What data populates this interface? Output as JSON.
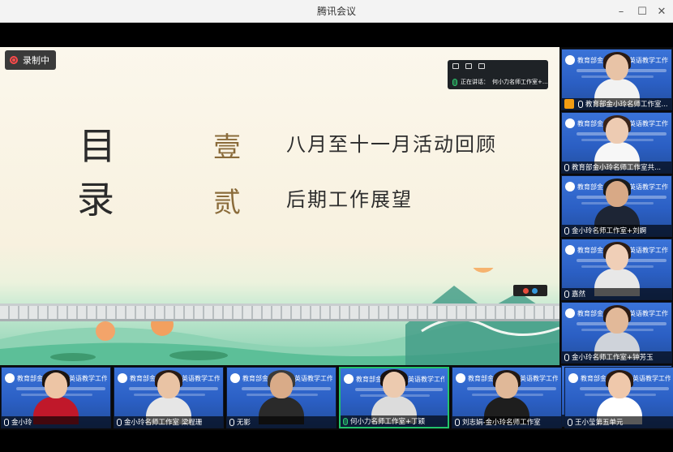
{
  "window": {
    "title": "腾讯会议",
    "controls": {
      "minimize": "–",
      "maximize": "☐",
      "close": "✕"
    }
  },
  "recording": {
    "label": "录制中"
  },
  "slide": {
    "toc_char_1": "目",
    "toc_char_2": "录",
    "items": [
      {
        "num": "壹",
        "text": "八月至十一月活动回顾"
      },
      {
        "num": "贰",
        "text": "后期工作展望"
      }
    ]
  },
  "speaker_panel": {
    "label": "正在讲话：",
    "speaker": "何小力名师工作室+..."
  },
  "side_tiles": [
    {
      "banner": "教育部金小玲快乐英语教学工作室",
      "caption": "教育部金小玲名师工作室...",
      "host": true,
      "face": "#e8c3a6",
      "hair": "#2a1a14",
      "body": "#f2f2f2"
    },
    {
      "banner": "教育部金小玲快乐英语教学工作室",
      "caption": "教育部金小玲名师工作室共...",
      "host": false,
      "face": "#edcbb2",
      "hair": "#3a2419",
      "body": "#f7f7f7"
    },
    {
      "banner": "教育部金小玲快乐英语教学工作室",
      "caption": "金小玲名师工作室+刘婀",
      "host": false,
      "face": "#d8a986",
      "hair": "#1a1a1a",
      "body": "#1d2535"
    },
    {
      "banner": "教育部金小玲快乐英语教学工作室",
      "caption": "嘉然",
      "host": false,
      "face": "#f0cfb7",
      "hair": "#2d1d15",
      "body": "#e8e8e8"
    },
    {
      "banner": "教育部金小玲快乐英语教学工作室",
      "caption": "金小玲名师工作室+钟芳玉",
      "host": false,
      "face": "#e2b999",
      "hair": "#2b1a12",
      "body": "#cfd3da"
    },
    {
      "banner": "教育部金小玲快乐英语教学工作室",
      "caption": "王小莹第五单元",
      "host": false,
      "face": "#efc8ab",
      "hair": "#2a1a12",
      "body": "#ffffff"
    }
  ],
  "bottom_tiles": [
    {
      "banner": "教育部金小玲快乐英语教学工作室",
      "caption": "金小玲",
      "active": false,
      "face": "#edc5a5",
      "hair": "#1c1410",
      "body": "#c0182a"
    },
    {
      "banner": "教育部金小玲快乐英语教学工作室",
      "caption": "金小玲名师工作室 梁程珊",
      "active": false,
      "face": "#e9c3a4",
      "hair": "#2a1b14",
      "body": "#e6e6e6"
    },
    {
      "banner": "教育部金小玲快乐英语教学工作室",
      "caption": "无影",
      "active": false,
      "face": "#d9ab88",
      "hair": "#3a3a3a",
      "body": "#2a2a2a"
    },
    {
      "banner": "教育部金小玲快乐英语教学工作室",
      "caption": "何小力名师工作室+丁颖",
      "active": true,
      "face": "#eccaaf",
      "hair": "#1a1210",
      "body": "#dcdcdc"
    },
    {
      "banner": "教育部金小玲快乐英语教学工作室",
      "caption": "刘志娟-金小玲名师工作室",
      "active": false,
      "face": "#e0b898",
      "hair": "#231813",
      "body": "#1e1e1e"
    },
    {
      "banner": "教育部金小玲快乐英语教学工作室",
      "caption": "王小莹第五单元",
      "active": false,
      "face": "#efc8ab",
      "hair": "#2a1a12",
      "body": "#ffffff"
    }
  ],
  "colors": {
    "active_border": "#23c36b",
    "tile_blue": "#2b5fc4",
    "record_red": "#ff4b4b"
  }
}
